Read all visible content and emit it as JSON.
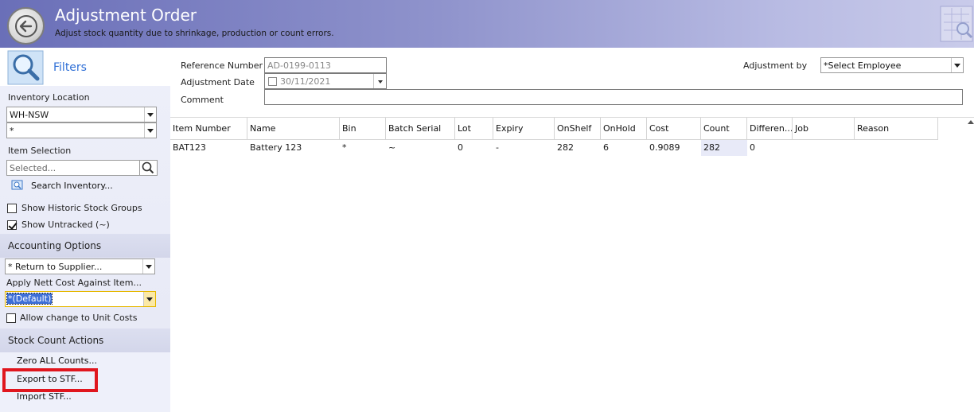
{
  "header": {
    "title": "Adjustment Order",
    "subtitle": "Adjust stock quantity due to shrinkage, production or count errors."
  },
  "sidebar": {
    "filters_label": "Filters",
    "inventory_location_label": "Inventory Location",
    "inventory_location_value": "WH-NSW",
    "inventory_sublocation_value": "*",
    "item_selection_label": "Item Selection",
    "item_selection_placeholder": "Selected...",
    "search_inventory_label": "Search Inventory...",
    "show_historic_label": "Show Historic Stock Groups",
    "show_historic_checked": false,
    "show_untracked_label": "Show Untracked (~)",
    "show_untracked_checked": true,
    "accounting_options_label": "Accounting Options",
    "accounting_option_value": "* Return to Supplier...",
    "apply_nett_cost_label": "Apply Nett Cost Against Item...",
    "apply_nett_cost_value": "*(Default)",
    "allow_change_label": "Allow change to Unit Costs",
    "allow_change_checked": false,
    "stock_count_actions_label": "Stock Count Actions",
    "actions": {
      "zero_all": "Zero ALL Counts...",
      "export_stf": "Export to STF...",
      "import_stf": "Import STF..."
    }
  },
  "form": {
    "reference_number_label": "Reference Number",
    "reference_number_value": "AD-0199-0113",
    "adjustment_date_label": "Adjustment Date",
    "adjustment_date_value": "30/11/2021",
    "comment_label": "Comment",
    "comment_value": "",
    "adjustment_by_label": "Adjustment by",
    "adjustment_by_value": "*Select Employee"
  },
  "grid": {
    "columns": [
      "Item Number",
      "Name",
      "Bin",
      "Batch Serial",
      "Lot",
      "Expiry",
      "OnShelf",
      "OnHold",
      "Cost",
      "Count",
      "Differen...",
      "Job",
      "Reason"
    ],
    "rows": [
      [
        "BAT123",
        "Battery 123",
        "*",
        "~",
        "0",
        "-",
        "282",
        "6",
        "0.9089",
        "282",
        "0",
        "",
        ""
      ]
    ]
  },
  "colors": {
    "header_start": "#6a6fb8",
    "header_end": "#c9cbea",
    "filters_blue": "#2f6fd6",
    "highlight_red": "#e0161e",
    "selection_blue": "#3d6fd8"
  }
}
